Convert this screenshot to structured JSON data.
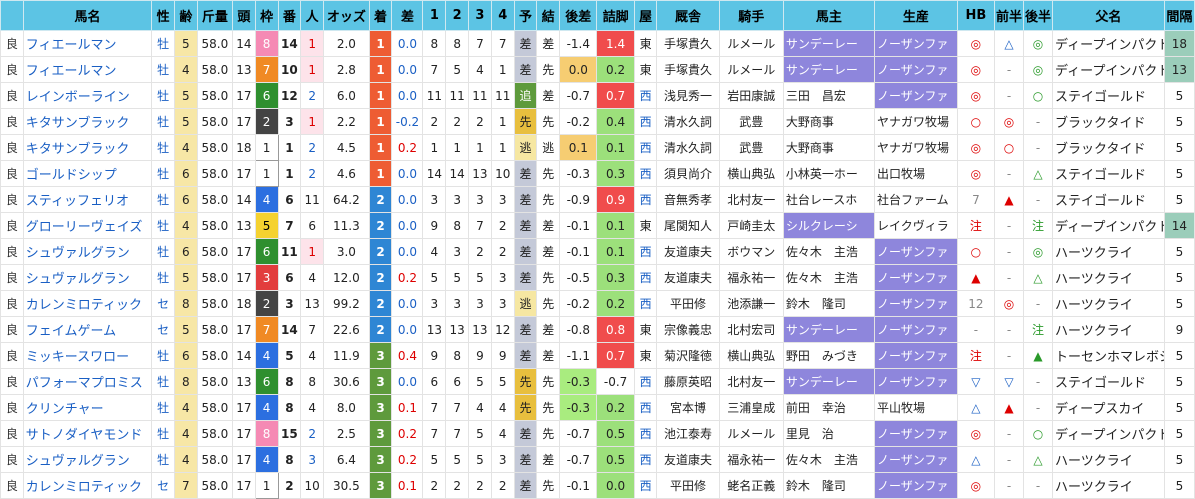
{
  "headers": [
    "",
    "馬名",
    "性",
    "齢",
    "斤量",
    "頭",
    "枠",
    "番",
    "人",
    "オッズ",
    "着",
    "差",
    "1",
    "2",
    "3",
    "4",
    "予",
    "結",
    "後差",
    "詰脚",
    "屋",
    "厩舎",
    "騎手",
    "馬主",
    "生産",
    "HB",
    "前半",
    "後半",
    "父名",
    "間隔"
  ],
  "rows": [
    {
      "baba": "良",
      "name": "フィエールマン",
      "sex": "牡",
      "age": "5",
      "kinryo": "58.0",
      "to": "14",
      "waku": "8",
      "umaban": "14",
      "ninki": "1",
      "odds": "2.0",
      "chaku": "1",
      "sa": "0.0",
      "p1": "8",
      "p2": "8",
      "p3": "7",
      "p4": "7",
      "yo": "差",
      "ketsu": "差",
      "kosa": "-1.4",
      "tsume": "1.4",
      "ya": "東",
      "kyu": "手塚貴久",
      "kishu": "ルメール",
      "banushi": "サンデーレー",
      "seisan": "ノーザンファ",
      "hb": "◎",
      "zen": "△",
      "ko": "◎",
      "chichi": "ディープインパクト",
      "kankaku": "18",
      "yo_cls": "yo-sa",
      "kd_cls": "",
      "sh_cls": "shoku-red",
      "own_hl": true,
      "br_hl": true,
      "int_hl": true
    },
    {
      "baba": "良",
      "name": "フィエールマン",
      "sex": "牡",
      "age": "4",
      "kinryo": "58.0",
      "to": "13",
      "waku": "7",
      "umaban": "10",
      "ninki": "1",
      "odds": "2.8",
      "chaku": "1",
      "sa": "0.0",
      "p1": "7",
      "p2": "5",
      "p3": "4",
      "p4": "1",
      "yo": "差",
      "ketsu": "先",
      "kosa": "0.0",
      "tsume": "0.2",
      "ya": "東",
      "kyu": "手塚貴久",
      "kishu": "ルメール",
      "banushi": "サンデーレー",
      "seisan": "ノーザンファ",
      "hb": "◎",
      "zen": "-",
      "ko": "◎",
      "chichi": "ディープインパクト",
      "kankaku": "13",
      "yo_cls": "yo-sa",
      "kd_cls": "kd-orange",
      "sh_cls": "shoku-green",
      "own_hl": true,
      "br_hl": true,
      "int_hl": true
    },
    {
      "baba": "良",
      "name": "レインボーライン",
      "sex": "牡",
      "age": "5",
      "kinryo": "58.0",
      "to": "17",
      "waku": "6",
      "umaban": "12",
      "ninki": "2",
      "odds": "6.0",
      "chaku": "1",
      "sa": "0.0",
      "p1": "11",
      "p2": "11",
      "p3": "11",
      "p4": "11",
      "yo": "追",
      "ketsu": "差",
      "kosa": "-0.7",
      "tsume": "0.7",
      "ya": "西",
      "kyu": "浅見秀一",
      "kishu": "岩田康誠",
      "banushi": "三田　昌宏",
      "seisan": "ノーザンファ",
      "hb": "◎",
      "zen": "-",
      "ko": "○",
      "chichi": "ステイゴールド",
      "kankaku": "5",
      "yo_cls": "yo-oi",
      "kd_cls": "",
      "sh_cls": "shoku-red",
      "own_hl": false,
      "br_hl": true,
      "int_hl": false
    },
    {
      "baba": "良",
      "name": "キタサンブラック",
      "sex": "牡",
      "age": "5",
      "kinryo": "58.0",
      "to": "17",
      "waku": "2",
      "umaban": "3",
      "ninki": "1",
      "odds": "2.2",
      "chaku": "1",
      "sa": "-0.2",
      "p1": "2",
      "p2": "2",
      "p3": "2",
      "p4": "1",
      "yo": "先",
      "ketsu": "先",
      "kosa": "-0.2",
      "tsume": "0.4",
      "ya": "西",
      "kyu": "清水久詞",
      "kishu": "武豊",
      "banushi": "大野商事",
      "seisan": "ヤナガワ牧場",
      "hb": "○",
      "zen": "◎",
      "ko": "-",
      "chichi": "ブラックタイド",
      "kankaku": "5",
      "yo_cls": "yo-sen",
      "kd_cls": "",
      "sh_cls": "shoku-green",
      "own_hl": false,
      "br_hl": false,
      "int_hl": false
    },
    {
      "baba": "良",
      "name": "キタサンブラック",
      "sex": "牡",
      "age": "4",
      "kinryo": "58.0",
      "to": "18",
      "waku": "1",
      "umaban": "1",
      "ninki": "2",
      "odds": "4.5",
      "chaku": "1",
      "sa": "0.2",
      "p1": "1",
      "p2": "1",
      "p3": "1",
      "p4": "1",
      "yo": "逃",
      "ketsu": "逃",
      "kosa": "0.1",
      "tsume": "0.1",
      "ya": "西",
      "kyu": "清水久詞",
      "kishu": "武豊",
      "banushi": "大野商事",
      "seisan": "ヤナガワ牧場",
      "hb": "◎",
      "zen": "○",
      "ko": "-",
      "chichi": "ブラックタイド",
      "kankaku": "5",
      "yo_cls": "yo-nige",
      "kd_cls": "kd-orange",
      "sh_cls": "shoku-green",
      "own_hl": false,
      "br_hl": false,
      "int_hl": false
    },
    {
      "baba": "良",
      "name": "ゴールドシップ",
      "sex": "牡",
      "age": "6",
      "kinryo": "58.0",
      "to": "17",
      "waku": "1",
      "umaban": "1",
      "ninki": "2",
      "odds": "4.6",
      "chaku": "1",
      "sa": "0.0",
      "p1": "14",
      "p2": "14",
      "p3": "13",
      "p4": "10",
      "yo": "差",
      "ketsu": "先",
      "kosa": "-0.3",
      "tsume": "0.3",
      "ya": "西",
      "kyu": "須貝尚介",
      "kishu": "横山典弘",
      "banushi": "小林英一ホー",
      "seisan": "出口牧場",
      "hb": "◎",
      "zen": "-",
      "ko": "△",
      "chichi": "ステイゴールド",
      "kankaku": "5",
      "yo_cls": "yo-sa",
      "kd_cls": "",
      "sh_cls": "shoku-green",
      "own_hl": false,
      "br_hl": false,
      "int_hl": false
    },
    {
      "baba": "良",
      "name": "スティッフェリオ",
      "sex": "牡",
      "age": "6",
      "kinryo": "58.0",
      "to": "14",
      "waku": "4",
      "umaban": "6",
      "ninki": "11",
      "odds": "64.2",
      "chaku": "2",
      "sa": "0.0",
      "p1": "3",
      "p2": "3",
      "p3": "3",
      "p4": "3",
      "yo": "差",
      "ketsu": "先",
      "kosa": "-0.9",
      "tsume": "0.9",
      "ya": "西",
      "kyu": "音無秀孝",
      "kishu": "北村友一",
      "banushi": "社台レースホ",
      "seisan": "社台ファーム",
      "hb": "7",
      "zen": "▲",
      "ko": "-",
      "chichi": "ステイゴールド",
      "kankaku": "5",
      "yo_cls": "yo-sa",
      "kd_cls": "",
      "sh_cls": "shoku-red",
      "own_hl": false,
      "br_hl": false,
      "int_hl": false
    },
    {
      "baba": "良",
      "name": "グローリーヴェイズ",
      "sex": "牡",
      "age": "4",
      "kinryo": "58.0",
      "to": "13",
      "waku": "5",
      "umaban": "7",
      "ninki": "6",
      "odds": "11.3",
      "chaku": "2",
      "sa": "0.0",
      "p1": "9",
      "p2": "8",
      "p3": "7",
      "p4": "2",
      "yo": "差",
      "ketsu": "差",
      "kosa": "-0.1",
      "tsume": "0.1",
      "ya": "東",
      "kyu": "尾関知人",
      "kishu": "戸崎圭太",
      "banushi": "シルクレーシ",
      "seisan": "レイクヴィラ",
      "hb": "注",
      "zen": "-",
      "ko": "注",
      "chichi": "ディープインパクト",
      "kankaku": "14",
      "yo_cls": "yo-sa",
      "kd_cls": "",
      "sh_cls": "shoku-green",
      "own_hl": true,
      "br_hl": false,
      "int_hl": true
    },
    {
      "baba": "良",
      "name": "シュヴァルグラン",
      "sex": "牡",
      "age": "6",
      "kinryo": "58.0",
      "to": "17",
      "waku": "6",
      "umaban": "11",
      "ninki": "1",
      "odds": "3.0",
      "chaku": "2",
      "sa": "0.0",
      "p1": "4",
      "p2": "3",
      "p3": "2",
      "p4": "2",
      "yo": "差",
      "ketsu": "差",
      "kosa": "-0.1",
      "tsume": "0.1",
      "ya": "西",
      "kyu": "友道康夫",
      "kishu": "ボウマン",
      "banushi": "佐々木　主浩",
      "seisan": "ノーザンファ",
      "hb": "○",
      "zen": "-",
      "ko": "◎",
      "chichi": "ハーツクライ",
      "kankaku": "5",
      "yo_cls": "yo-sa",
      "kd_cls": "",
      "sh_cls": "shoku-green",
      "own_hl": false,
      "br_hl": true,
      "int_hl": false
    },
    {
      "baba": "良",
      "name": "シュヴァルグラン",
      "sex": "牡",
      "age": "5",
      "kinryo": "58.0",
      "to": "17",
      "waku": "3",
      "umaban": "6",
      "ninki": "4",
      "odds": "12.0",
      "chaku": "2",
      "sa": "0.2",
      "p1": "5",
      "p2": "5",
      "p3": "5",
      "p4": "3",
      "yo": "差",
      "ketsu": "先",
      "kosa": "-0.5",
      "tsume": "0.3",
      "ya": "西",
      "kyu": "友道康夫",
      "kishu": "福永祐一",
      "banushi": "佐々木　主浩",
      "seisan": "ノーザンファ",
      "hb": "▲",
      "zen": "-",
      "ko": "△",
      "chichi": "ハーツクライ",
      "kankaku": "5",
      "yo_cls": "yo-sa",
      "kd_cls": "",
      "sh_cls": "shoku-green",
      "own_hl": false,
      "br_hl": true,
      "int_hl": false
    },
    {
      "baba": "良",
      "name": "カレンミロティック",
      "sex": "セ",
      "age": "8",
      "kinryo": "58.0",
      "to": "18",
      "waku": "2",
      "umaban": "3",
      "ninki": "13",
      "odds": "99.2",
      "chaku": "2",
      "sa": "0.0",
      "p1": "3",
      "p2": "3",
      "p3": "3",
      "p4": "3",
      "yo": "逃",
      "ketsu": "先",
      "kosa": "-0.2",
      "tsume": "0.2",
      "ya": "西",
      "kyu": "平田修",
      "kishu": "池添謙一",
      "banushi": "鈴木　隆司",
      "seisan": "ノーザンファ",
      "hb": "12",
      "zen": "◎",
      "ko": "-",
      "chichi": "ハーツクライ",
      "kankaku": "5",
      "yo_cls": "yo-nige",
      "kd_cls": "",
      "sh_cls": "shoku-green",
      "own_hl": false,
      "br_hl": true,
      "int_hl": false
    },
    {
      "baba": "良",
      "name": "フェイムゲーム",
      "sex": "セ",
      "age": "5",
      "kinryo": "58.0",
      "to": "17",
      "waku": "7",
      "umaban": "14",
      "ninki": "7",
      "odds": "22.6",
      "chaku": "2",
      "sa": "0.0",
      "p1": "13",
      "p2": "13",
      "p3": "13",
      "p4": "12",
      "yo": "差",
      "ketsu": "差",
      "kosa": "-0.8",
      "tsume": "0.8",
      "ya": "東",
      "kyu": "宗像義忠",
      "kishu": "北村宏司",
      "banushi": "サンデーレー",
      "seisan": "ノーザンファ",
      "hb": "-",
      "zen": "-",
      "ko": "注",
      "chichi": "ハーツクライ",
      "kankaku": "9",
      "yo_cls": "yo-sa",
      "kd_cls": "",
      "sh_cls": "shoku-red",
      "own_hl": true,
      "br_hl": true,
      "int_hl": false
    },
    {
      "baba": "良",
      "name": "ミッキースワロー",
      "sex": "牡",
      "age": "6",
      "kinryo": "58.0",
      "to": "14",
      "waku": "4",
      "umaban": "5",
      "ninki": "4",
      "odds": "11.9",
      "chaku": "3",
      "sa": "0.4",
      "p1": "9",
      "p2": "8",
      "p3": "9",
      "p4": "9",
      "yo": "差",
      "ketsu": "差",
      "kosa": "-1.1",
      "tsume": "0.7",
      "ya": "東",
      "kyu": "菊沢隆徳",
      "kishu": "横山典弘",
      "banushi": "野田　みづき",
      "seisan": "ノーザンファ",
      "hb": "注",
      "zen": "-",
      "ko": "▲",
      "chichi": "トーセンホマレボシ",
      "kankaku": "5",
      "yo_cls": "yo-sa",
      "kd_cls": "",
      "sh_cls": "shoku-red",
      "own_hl": false,
      "br_hl": true,
      "int_hl": false
    },
    {
      "baba": "良",
      "name": "パフォーマプロミス",
      "sex": "牡",
      "age": "8",
      "kinryo": "58.0",
      "to": "13",
      "waku": "6",
      "umaban": "8",
      "ninki": "8",
      "odds": "30.6",
      "chaku": "3",
      "sa": "0.0",
      "p1": "6",
      "p2": "6",
      "p3": "5",
      "p4": "5",
      "yo": "先",
      "ketsu": "先",
      "kosa": "-0.3",
      "tsume": "-0.7",
      "ya": "西",
      "kyu": "藤原英昭",
      "kishu": "北村友一",
      "banushi": "サンデーレー",
      "seisan": "ノーザンファ",
      "hb": "▽",
      "zen": "▽",
      "ko": "-",
      "chichi": "ステイゴールド",
      "kankaku": "5",
      "yo_cls": "yo-sen",
      "kd_cls": "kd-green",
      "sh_cls": "",
      "own_hl": true,
      "br_hl": true,
      "int_hl": false
    },
    {
      "baba": "良",
      "name": "クリンチャー",
      "sex": "牡",
      "age": "4",
      "kinryo": "58.0",
      "to": "17",
      "waku": "4",
      "umaban": "8",
      "ninki": "4",
      "odds": "8.0",
      "chaku": "3",
      "sa": "0.1",
      "p1": "7",
      "p2": "7",
      "p3": "4",
      "p4": "4",
      "yo": "先",
      "ketsu": "先",
      "kosa": "-0.3",
      "tsume": "0.2",
      "ya": "西",
      "kyu": "宮本博",
      "kishu": "三浦皇成",
      "banushi": "前田　幸治",
      "seisan": "平山牧場",
      "hb": "△",
      "zen": "▲",
      "ko": "-",
      "chichi": "ディープスカイ",
      "kankaku": "5",
      "yo_cls": "yo-sen",
      "kd_cls": "kd-green",
      "sh_cls": "shoku-green",
      "own_hl": false,
      "br_hl": false,
      "int_hl": false
    },
    {
      "baba": "良",
      "name": "サトノダイヤモンド",
      "sex": "牡",
      "age": "4",
      "kinryo": "58.0",
      "to": "17",
      "waku": "8",
      "umaban": "15",
      "ninki": "2",
      "odds": "2.5",
      "chaku": "3",
      "sa": "0.2",
      "p1": "7",
      "p2": "7",
      "p3": "5",
      "p4": "4",
      "yo": "差",
      "ketsu": "先",
      "kosa": "-0.7",
      "tsume": "0.5",
      "ya": "西",
      "kyu": "池江泰寿",
      "kishu": "ルメール",
      "banushi": "里見　治",
      "seisan": "ノーザンファ",
      "hb": "◎",
      "zen": "-",
      "ko": "○",
      "chichi": "ディープインパクト",
      "kankaku": "5",
      "yo_cls": "yo-sa",
      "kd_cls": "",
      "sh_cls": "shoku-green",
      "own_hl": false,
      "br_hl": true,
      "int_hl": false
    },
    {
      "baba": "良",
      "name": "シュヴァルグラン",
      "sex": "牡",
      "age": "4",
      "kinryo": "58.0",
      "to": "17",
      "waku": "4",
      "umaban": "8",
      "ninki": "3",
      "odds": "6.4",
      "chaku": "3",
      "sa": "0.2",
      "p1": "5",
      "p2": "5",
      "p3": "5",
      "p4": "3",
      "yo": "差",
      "ketsu": "差",
      "kosa": "-0.7",
      "tsume": "0.5",
      "ya": "西",
      "kyu": "友道康夫",
      "kishu": "福永祐一",
      "banushi": "佐々木　主浩",
      "seisan": "ノーザンファ",
      "hb": "△",
      "zen": "-",
      "ko": "△",
      "chichi": "ハーツクライ",
      "kankaku": "5",
      "yo_cls": "yo-sa",
      "kd_cls": "",
      "sh_cls": "shoku-green",
      "own_hl": false,
      "br_hl": true,
      "int_hl": false
    },
    {
      "baba": "良",
      "name": "カレンミロティック",
      "sex": "セ",
      "age": "7",
      "kinryo": "58.0",
      "to": "17",
      "waku": "1",
      "umaban": "2",
      "ninki": "10",
      "odds": "30.5",
      "chaku": "3",
      "sa": "0.1",
      "p1": "2",
      "p2": "2",
      "p3": "2",
      "p4": "2",
      "yo": "差",
      "ketsu": "先",
      "kosa": "-0.1",
      "tsume": "0.0",
      "ya": "西",
      "kyu": "平田修",
      "kishu": "蛯名正義",
      "banushi": "鈴木　隆司",
      "seisan": "ノーザンファ",
      "hb": "◎",
      "zen": "-",
      "ko": "-",
      "chichi": "ハーツクライ",
      "kankaku": "5",
      "yo_cls": "yo-sa",
      "kd_cls": "",
      "sh_cls": "shoku-green",
      "own_hl": false,
      "br_hl": true,
      "int_hl": false
    }
  ]
}
